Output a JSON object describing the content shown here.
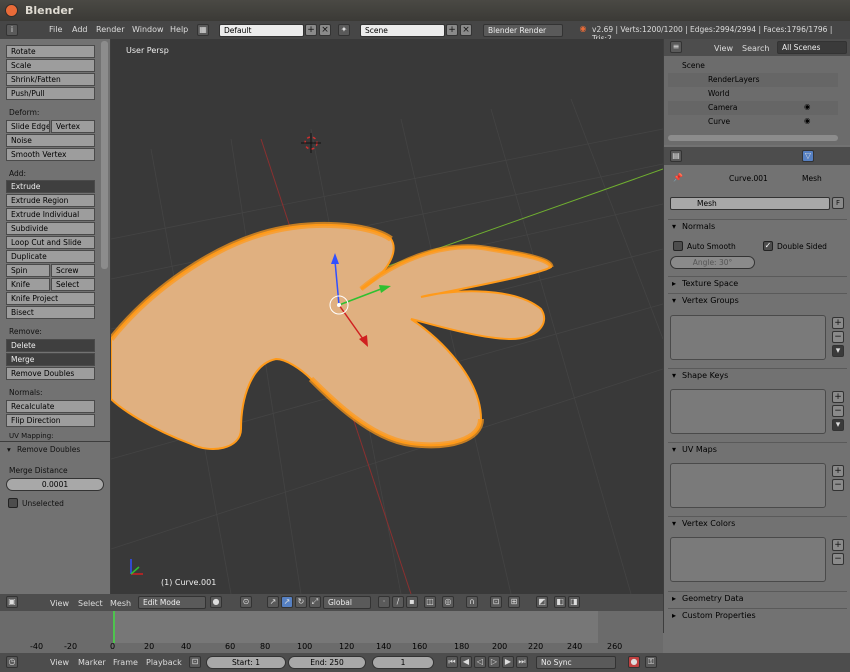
{
  "window": {
    "title": "Blender"
  },
  "menubar": {
    "menus": [
      "File",
      "Add",
      "Render",
      "Window",
      "Help"
    ],
    "layout": "Default",
    "scene": "Scene",
    "engine": "Blender Render",
    "stats": "v2.69 | Verts:1200/1200 | Edges:2994/2994 | Faces:1796/1796 | Tris:2"
  },
  "toolshelf": {
    "transform_buttons": [
      "Rotate",
      "Scale",
      "Shrink/Fatten",
      "Push/Pull"
    ],
    "deform_label": "Deform:",
    "slide_edge": "Slide Edge",
    "vertex": "Vertex",
    "noise": "Noise",
    "smooth_vertex": "Smooth Vertex",
    "add_label": "Add:",
    "extrude": "Extrude",
    "extrude_region": "Extrude Region",
    "extrude_individual": "Extrude Individual",
    "subdivide": "Subdivide",
    "loop_cut": "Loop Cut and Slide",
    "duplicate": "Duplicate",
    "spin": "Spin",
    "screw": "Screw",
    "knife": "Knife",
    "select": "Select",
    "knife_project": "Knife Project",
    "bisect": "Bisect",
    "remove_label": "Remove:",
    "delete": "Delete",
    "merge": "Merge",
    "remove_doubles": "Remove Doubles",
    "normals_label": "Normals:",
    "recalculate": "Recalculate",
    "flip_direction": "Flip Direction",
    "uv_label": "UV Mapping:",
    "operator_title": "Remove Doubles",
    "merge_distance_label": "Merge Distance",
    "merge_distance_value": "0.0001",
    "unselected": "Unselected"
  },
  "viewport": {
    "view_name": "User Persp",
    "object_name": "(1) Curve.001"
  },
  "outliner": {
    "view": "View",
    "search": "Search",
    "all_scenes": "All Scenes",
    "items": [
      "Scene",
      "RenderLayers",
      "World",
      "Camera",
      "Curve"
    ]
  },
  "properties": {
    "breadcrumb_object": "Curve.001",
    "breadcrumb_data": "Mesh",
    "data_name": "Mesh",
    "fake_user": "F",
    "panels": {
      "normals": "Normals",
      "auto_smooth": "Auto Smooth",
      "double_sided": "Double Sided",
      "angle": "Angle: 30°",
      "texture_space": "Texture Space",
      "vertex_groups": "Vertex Groups",
      "shape_keys": "Shape Keys",
      "uv_maps": "UV Maps",
      "vertex_colors": "Vertex Colors",
      "geometry_data": "Geometry Data",
      "custom_properties": "Custom Properties"
    }
  },
  "view3d_header": {
    "view": "View",
    "select": "Select",
    "mesh": "Mesh",
    "mode": "Edit Mode",
    "orientation": "Global"
  },
  "timeline": {
    "ticks": [
      "-40",
      "-20",
      "0",
      "20",
      "40",
      "60",
      "80",
      "100",
      "120",
      "140",
      "160",
      "180",
      "200",
      "220",
      "240",
      "260"
    ],
    "view": "View",
    "marker": "Marker",
    "frame": "Frame",
    "playback": "Playback",
    "start": "Start: 1",
    "end": "End: 250",
    "current": "1",
    "sync": "No Sync"
  },
  "colors": {
    "accent": "#e96b38",
    "selection": "#ff9a1a",
    "grid_x": "#a03030",
    "grid_y": "#70b030"
  }
}
